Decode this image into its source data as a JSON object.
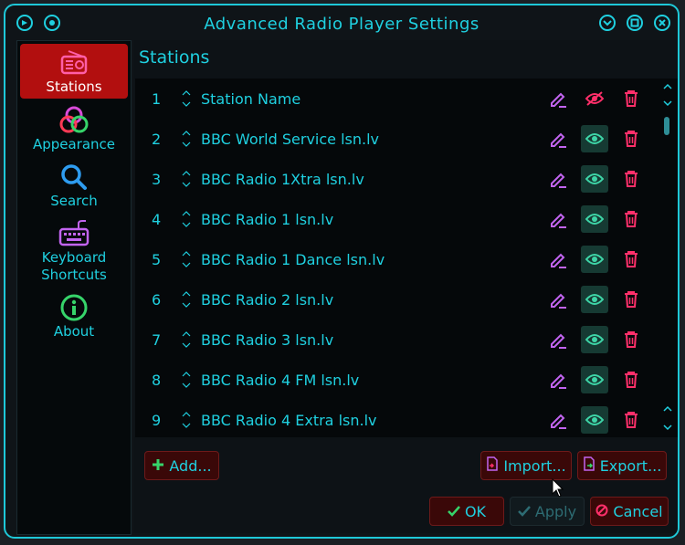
{
  "window": {
    "title": "Advanced Radio Player Settings"
  },
  "sidebar": {
    "items": [
      {
        "label": "Stations",
        "icon": "radio-icon"
      },
      {
        "label": "Appearance",
        "icon": "palette-icon"
      },
      {
        "label": "Search",
        "icon": "search-icon"
      },
      {
        "label": "Keyboard\nShortcuts",
        "icon": "keyboard-icon"
      },
      {
        "label": "About",
        "icon": "info-icon"
      }
    ]
  },
  "main": {
    "title": "Stations",
    "stations": [
      {
        "num": "1",
        "name": "Station Name",
        "visible": false
      },
      {
        "num": "2",
        "name": "BBC World Service lsn.lv",
        "visible": true
      },
      {
        "num": "3",
        "name": "BBC Radio 1Xtra lsn.lv",
        "visible": true
      },
      {
        "num": "4",
        "name": "BBC Radio 1 lsn.lv",
        "visible": true
      },
      {
        "num": "5",
        "name": "BBC Radio 1 Dance lsn.lv",
        "visible": true
      },
      {
        "num": "6",
        "name": "BBC Radio 2 lsn.lv",
        "visible": true
      },
      {
        "num": "7",
        "name": "BBC Radio 3 lsn.lv",
        "visible": true
      },
      {
        "num": "8",
        "name": "BBC Radio 4 FM lsn.lv",
        "visible": true
      },
      {
        "num": "9",
        "name": "BBC Radio 4 Extra lsn.lv",
        "visible": true
      }
    ],
    "buttons": {
      "add": "Add...",
      "import": "Import...",
      "export": "Export...",
      "ok": "OK",
      "apply": "Apply",
      "cancel": "Cancel"
    }
  },
  "colors": {
    "accent": "#1fd0e0",
    "active": "#b20f0f",
    "edit": "#c264f0",
    "delete": "#ff2f6a",
    "visible": "#3ed6a8"
  }
}
